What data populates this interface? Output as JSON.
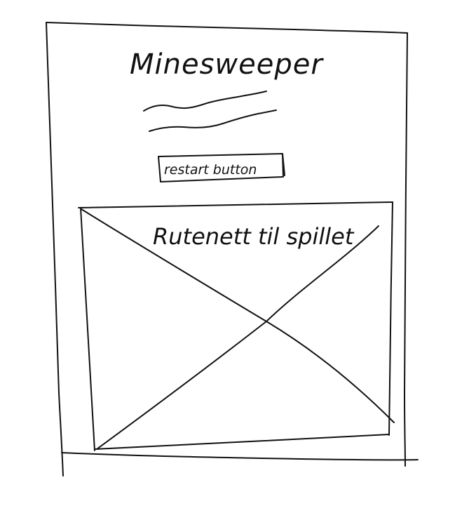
{
  "sketch": {
    "title": "Minesweeper",
    "restart_button_label": "restart button",
    "grid_label": "Rutenett til spillet",
    "icons": {
      "subtitle_placeholder": "squiggle-lines-icon",
      "grid_placeholder": "cross-placeholder-icon"
    }
  }
}
